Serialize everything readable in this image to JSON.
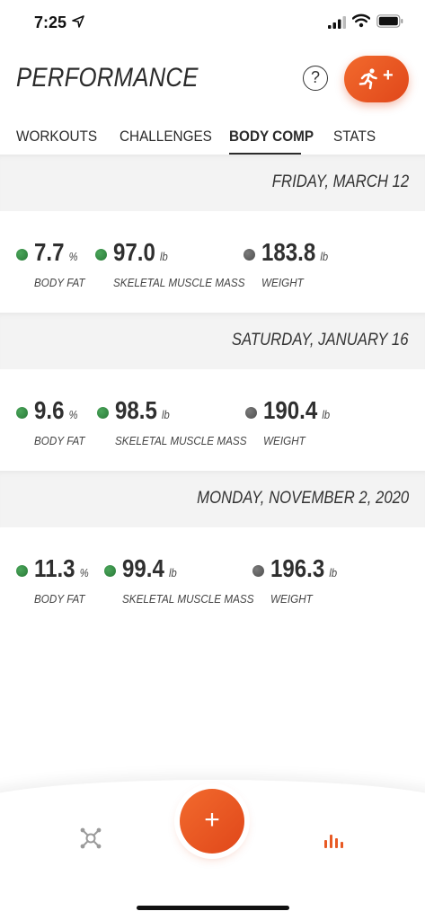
{
  "status_bar": {
    "time": "7:25"
  },
  "header": {
    "title": "PERFORMANCE",
    "help_label": "?",
    "workout_add_plus": "+"
  },
  "tabs": [
    {
      "label": "WORKOUTS",
      "active": false
    },
    {
      "label": "CHALLENGES",
      "active": false
    },
    {
      "label": "BODY COMP",
      "active": true
    },
    {
      "label": "STATS",
      "active": false
    }
  ],
  "entries": [
    {
      "date": "FRIDAY, MARCH 12",
      "body_fat": {
        "value": "7.7",
        "unit": "%",
        "label": "BODY FAT",
        "color": "green"
      },
      "muscle_mass": {
        "value": "97.0",
        "unit": "lb",
        "label": "SKELETAL MUSCLE MASS",
        "color": "green"
      },
      "weight": {
        "value": "183.8",
        "unit": "lb",
        "label": "WEIGHT",
        "color": "gray"
      }
    },
    {
      "date": "SATURDAY, JANUARY 16",
      "body_fat": {
        "value": "9.6",
        "unit": "%",
        "label": "BODY FAT",
        "color": "green"
      },
      "muscle_mass": {
        "value": "98.5",
        "unit": "lb",
        "label": "SKELETAL MUSCLE MASS",
        "color": "green"
      },
      "weight": {
        "value": "190.4",
        "unit": "lb",
        "label": "WEIGHT",
        "color": "gray"
      }
    },
    {
      "date": "MONDAY, NOVEMBER 2, 2020",
      "body_fat": {
        "value": "11.3",
        "unit": "%",
        "label": "BODY FAT",
        "color": "green"
      },
      "muscle_mass": {
        "value": "99.4",
        "unit": "lb",
        "label": "SKELETAL MUSCLE MASS",
        "color": "green"
      },
      "weight": {
        "value": "196.3",
        "unit": "lb",
        "label": "WEIGHT",
        "color": "gray"
      }
    }
  ],
  "bottom_nav": {
    "add_label": "+"
  },
  "colors": {
    "accent": "#e85a24",
    "status_green": "#2f8a3e",
    "status_gray": "#5a5a5a"
  }
}
